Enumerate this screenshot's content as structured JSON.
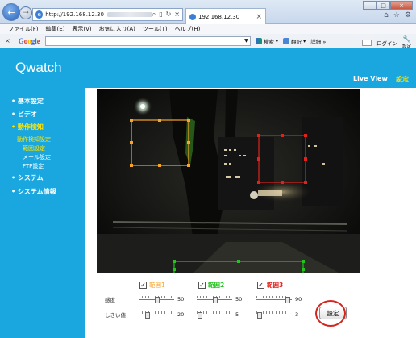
{
  "browser": {
    "url": "http://192.168.12.30",
    "tab_title": "192.168.12.30",
    "menu": [
      "ファイル(F)",
      "編集(E)",
      "表示(V)",
      "お気に入り(A)",
      "ツール(T)",
      "ヘルプ(H)"
    ],
    "google_toolbar": {
      "close": "×",
      "logo": "Google",
      "search_label": "検索",
      "translate_label": "翻訳",
      "details_label": "詳細 »",
      "login_label": "ログイン",
      "settings_label": "設定"
    }
  },
  "header": {
    "title": "Qwatch",
    "nav_live": "Live View",
    "nav_settings": "設定"
  },
  "sidebar": {
    "items": [
      {
        "label": "• 基本設定"
      },
      {
        "label": "• ビデオ"
      },
      {
        "label": "• 動作検知"
      },
      {
        "label": "• システム"
      },
      {
        "label": "• システム情報"
      }
    ],
    "sub_items": [
      {
        "label": "動作検知設定"
      },
      {
        "label": "範囲設定"
      },
      {
        "label": "メール設定"
      },
      {
        "label": "FTP設定"
      }
    ]
  },
  "regions": [
    {
      "label": "範囲1",
      "checked": true,
      "color": "#f7a42a",
      "sensitivity": "50",
      "threshold": "20"
    },
    {
      "label": "範囲2",
      "checked": true,
      "color": "#22c41d",
      "sensitivity": "50",
      "threshold": "5"
    },
    {
      "label": "範囲3",
      "checked": true,
      "color": "#e0221c",
      "sensitivity": "90",
      "threshold": "3"
    }
  ],
  "controls": {
    "sensitivity_label": "感度",
    "threshold_label": "しきい値",
    "submit_label": "設定",
    "checkmark": "✓"
  },
  "colors": {
    "accent": "#1aa7e0",
    "active_nav": "#ffe600",
    "highlight_circle": "#d5251d"
  }
}
